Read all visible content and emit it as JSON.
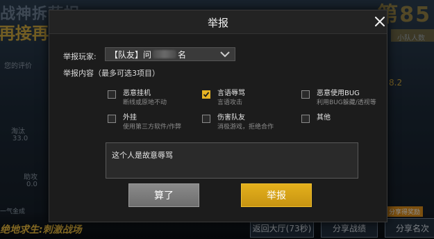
{
  "background": {
    "title_line1": "战神拆萨拐",
    "title_line2": "再接再",
    "rank_text": "第85",
    "side_labels": [
      "您的评价",
      "淘汰",
      "33.0",
      "助攻",
      "0.0",
      "一气金成"
    ],
    "right_labels": [
      "8.2",
      "分享战绩",
      "小队人数"
    ],
    "slogan": "绝地求生:刺激战场",
    "return_button": "返回大厅(73秒)",
    "share_record_button": "分享战绩",
    "share_card_button": "分享名次",
    "share_badge": "分享得奖励"
  },
  "dialog": {
    "title": "举报",
    "player_label": "举报玩家:",
    "player_value_prefix": "【队友】问",
    "player_value_suffix": "名",
    "content_label": "举报内容（最多可选3项目）",
    "options": [
      {
        "title": "恶意挂机",
        "desc": "断线或原地不动",
        "checked": false
      },
      {
        "title": "言语辱骂",
        "desc": "言语攻击",
        "checked": true
      },
      {
        "title": "恶意使用BUG",
        "desc": "利用BUG躲藏/透视等",
        "checked": false
      },
      {
        "title": "外挂",
        "desc": "使用第三方软件/作弊",
        "checked": false
      },
      {
        "title": "伤害队友",
        "desc": "消极游戏，拒绝合作",
        "checked": false
      },
      {
        "title": "其他",
        "desc": "",
        "checked": false
      }
    ],
    "textarea_value": "这个人是故意辱骂",
    "cancel_label": "算了",
    "report_label": "举报"
  },
  "colors": {
    "accent": "#e7b424",
    "dialog_bg": "#1c1c1c",
    "cancel_bg": "#7c7c7c"
  }
}
